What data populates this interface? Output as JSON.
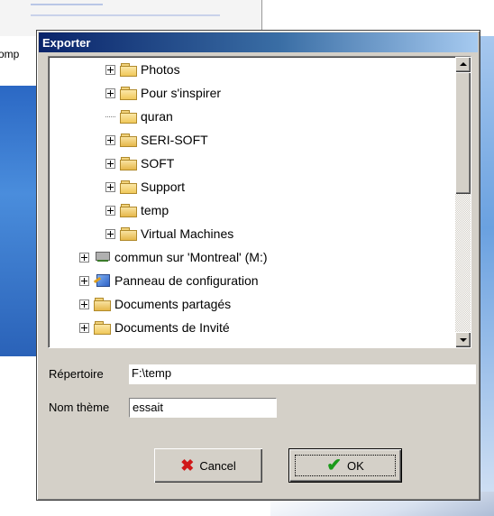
{
  "background": {
    "left_window_label": "omp"
  },
  "dialog": {
    "title": "Exporter",
    "tree": {
      "items": [
        {
          "label": "Photos",
          "type": "folder",
          "expandable": true
        },
        {
          "label": "Pour s'inspirer",
          "type": "folder",
          "expandable": true
        },
        {
          "label": "quran",
          "type": "folder",
          "expandable": false
        },
        {
          "label": "SERI-SOFT",
          "type": "shared-folder",
          "expandable": true
        },
        {
          "label": "SOFT",
          "type": "shared-folder",
          "expandable": true
        },
        {
          "label": "Support",
          "type": "folder",
          "expandable": true
        },
        {
          "label": "temp",
          "type": "shared-folder",
          "expandable": true
        },
        {
          "label": "Virtual Machines",
          "type": "shared-folder",
          "expandable": true
        },
        {
          "label": "commun sur 'Montreal' (M:)",
          "type": "network-drive",
          "expandable": true
        },
        {
          "label": "Panneau de configuration",
          "type": "control-panel",
          "expandable": true
        },
        {
          "label": "Documents partagés",
          "type": "shared-folder",
          "expandable": true
        },
        {
          "label": "Documents de Invité",
          "type": "folder",
          "expandable": true
        }
      ]
    },
    "repertoire": {
      "label": "Répertoire",
      "value": "F:\\temp"
    },
    "nom_theme": {
      "label": "Nom thème",
      "value": "essait"
    },
    "buttons": {
      "cancel_label": "Cancel",
      "ok_label": "OK"
    }
  }
}
